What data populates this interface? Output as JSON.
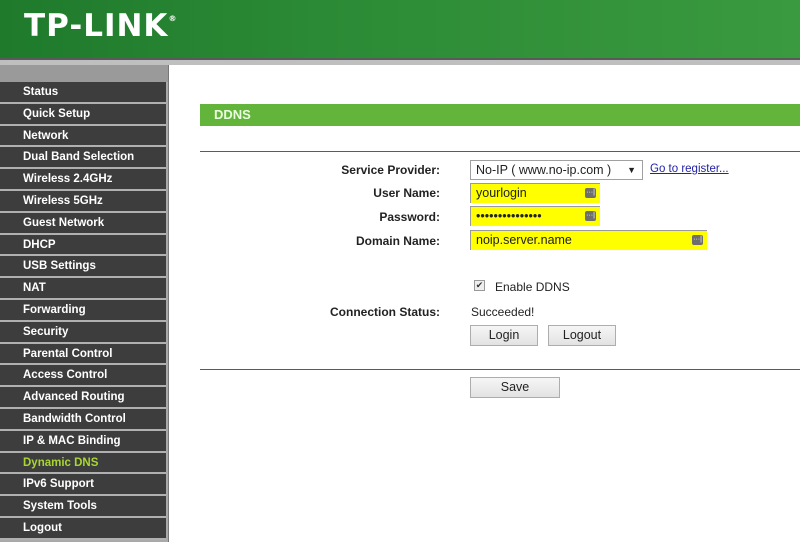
{
  "header": {
    "logo_text": "TP-LINK",
    "registered": "®"
  },
  "sidebar": {
    "items": [
      {
        "label": "Status"
      },
      {
        "label": "Quick Setup"
      },
      {
        "label": "Network"
      },
      {
        "label": "Dual Band Selection"
      },
      {
        "label": "Wireless 2.4GHz"
      },
      {
        "label": "Wireless 5GHz"
      },
      {
        "label": "Guest Network"
      },
      {
        "label": "DHCP"
      },
      {
        "label": "USB Settings"
      },
      {
        "label": "NAT"
      },
      {
        "label": "Forwarding"
      },
      {
        "label": "Security"
      },
      {
        "label": "Parental Control"
      },
      {
        "label": "Access Control"
      },
      {
        "label": "Advanced Routing"
      },
      {
        "label": "Bandwidth Control"
      },
      {
        "label": "IP & MAC Binding"
      },
      {
        "label": "Dynamic DNS"
      },
      {
        "label": "IPv6 Support"
      },
      {
        "label": "System Tools"
      },
      {
        "label": "Logout"
      }
    ],
    "active": "Dynamic DNS"
  },
  "main": {
    "title": "DDNS",
    "service_provider": {
      "label": "Service Provider:",
      "value": "No-IP ( www.no-ip.com )",
      "arrow": "▼"
    },
    "register_link": "Go to register...",
    "user_name": {
      "label": "User Name:",
      "value": "yourlogin"
    },
    "password": {
      "label": "Password:",
      "value": "•••••••••••••••"
    },
    "domain_name": {
      "label": "Domain Name:",
      "value": "noip.server.name"
    },
    "enable_ddns": {
      "label": "Enable DDNS",
      "checked": true,
      "mark": "✔"
    },
    "connection_status": {
      "label": "Connection Status:",
      "value": "Succeeded!"
    },
    "login_button": "Login",
    "logout_button": "Logout",
    "save_button": "Save",
    "key_icon_glyph": "···|"
  },
  "colors": {
    "header_green": "#2b8a35",
    "title_green": "#62b43a",
    "active_menu": "#a8d630",
    "autofill_yellow": "#ffff00"
  }
}
